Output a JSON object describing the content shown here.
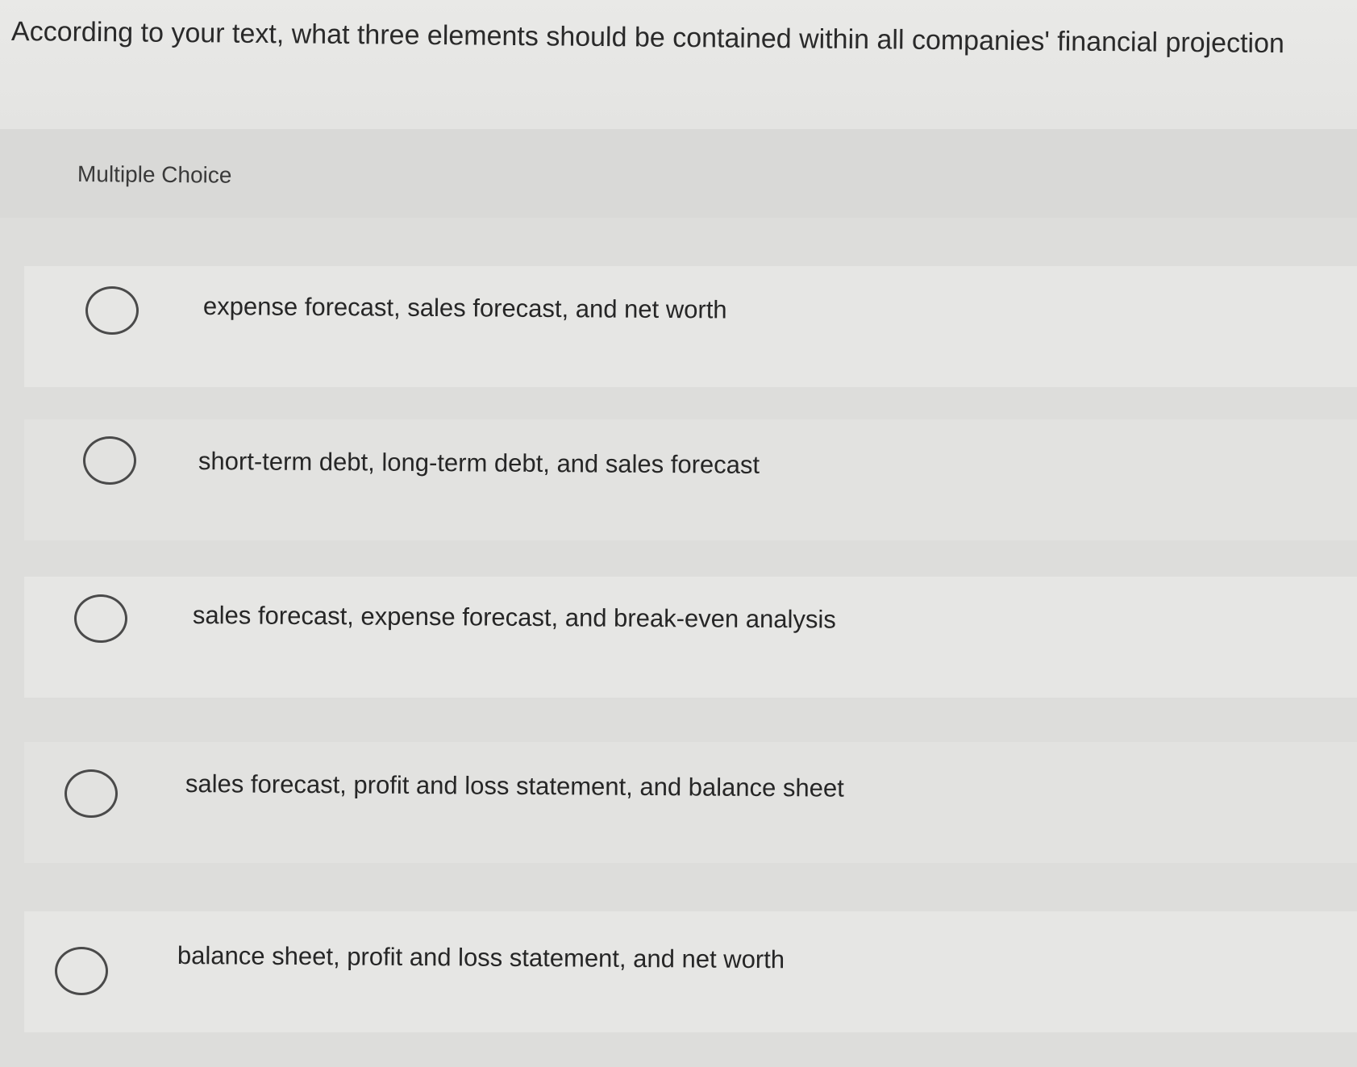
{
  "question": {
    "text": "According to your text, what three elements should be contained within all companies' financial projection"
  },
  "section_label": "Multiple Choice",
  "choices": [
    {
      "label": "expense forecast, sales forecast, and net worth"
    },
    {
      "label": "short-term debt, long-term debt, and sales forecast"
    },
    {
      "label": "sales forecast, expense forecast, and break-even analysis"
    },
    {
      "label": "sales forecast, profit and loss statement, and balance sheet"
    },
    {
      "label": "balance sheet, profit and loss statement, and net worth"
    }
  ],
  "colors": {
    "background": "#e3e3e1",
    "header_band": "#d9d9d7",
    "text": "#2b2b2b",
    "radio_border": "#4a4a4a"
  }
}
